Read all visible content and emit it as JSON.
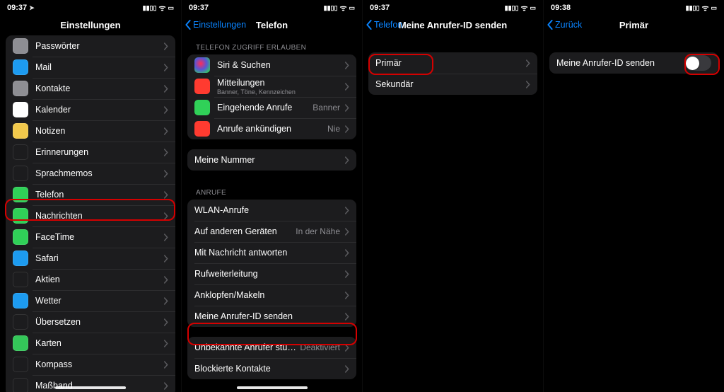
{
  "status": {
    "t1": "09:37",
    "t2": "09:37",
    "t3": "09:37",
    "t4": "09:38",
    "signal": "▮▮▯▯",
    "wifi": "📶",
    "battery": "▮▯"
  },
  "screen1": {
    "title": "Einstellungen",
    "items": [
      {
        "label": "Passwörter",
        "color": "#8e8e93"
      },
      {
        "label": "Mail",
        "color": "#1d9bf0"
      },
      {
        "label": "Kontakte",
        "color": "#8e8e93"
      },
      {
        "label": "Kalender",
        "color": "#ffffff"
      },
      {
        "label": "Notizen",
        "color": "#f2c94c"
      },
      {
        "label": "Erinnerungen",
        "color": "#1c1c1e"
      },
      {
        "label": "Sprachmemos",
        "color": "#1c1c1e"
      },
      {
        "label": "Telefon",
        "color": "#30d158"
      },
      {
        "label": "Nachrichten",
        "color": "#30d158"
      },
      {
        "label": "FaceTime",
        "color": "#30d158"
      },
      {
        "label": "Safari",
        "color": "#1d9bf0"
      },
      {
        "label": "Aktien",
        "color": "#1c1c1e"
      },
      {
        "label": "Wetter",
        "color": "#1d9bf0"
      },
      {
        "label": "Übersetzen",
        "color": "#1c1c1e"
      },
      {
        "label": "Karten",
        "color": "#34c759"
      },
      {
        "label": "Kompass",
        "color": "#1c1c1e"
      },
      {
        "label": "Maßband",
        "color": "#1c1c1e"
      }
    ]
  },
  "screen2": {
    "back": "Einstellungen",
    "title": "Telefon",
    "section1_header": "TELEFON ZUGRIFF ERLAUBEN",
    "rows1": [
      {
        "label": "Siri & Suchen",
        "color": "siri"
      },
      {
        "label": "Mitteilungen",
        "sub": "Banner, Töne, Kennzeichen",
        "color": "#ff3b30"
      },
      {
        "label": "Eingehende Anrufe",
        "value": "Banner",
        "color": "#30d158"
      },
      {
        "label": "Anrufe ankündigen",
        "value": "Nie",
        "color": "#ff3b30"
      }
    ],
    "rows2": [
      {
        "label": "Meine Nummer"
      }
    ],
    "section3_header": "ANRUFE",
    "rows3": [
      {
        "label": "WLAN-Anrufe"
      },
      {
        "label": "Auf anderen Geräten",
        "value": "In der Nähe"
      },
      {
        "label": "Mit Nachricht antworten"
      },
      {
        "label": "Rufweiterleitung"
      },
      {
        "label": "Anklopfen/Makeln"
      },
      {
        "label": "Meine Anrufer-ID senden"
      }
    ],
    "rows4": [
      {
        "label": "Unbekannte Anrufer stumm",
        "value": "Deaktiviert"
      },
      {
        "label": "Blockierte Kontakte"
      }
    ]
  },
  "screen3": {
    "back": "Telefon",
    "title": "Meine Anrufer-ID senden",
    "rows": [
      {
        "label": "Primär"
      },
      {
        "label": "Sekundär"
      }
    ]
  },
  "screen4": {
    "back": "Zurück",
    "title": "Primär",
    "row_label": "Meine Anrufer-ID senden"
  }
}
